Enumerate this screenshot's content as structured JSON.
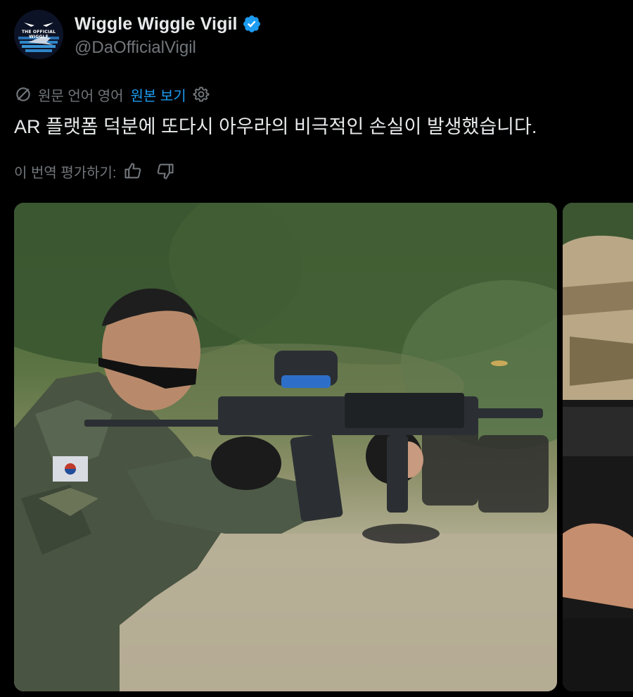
{
  "profile": {
    "display_name": "Wiggle Wiggle Vigil",
    "handle": "@DaOfficialVigil",
    "avatar_text": "THE OFFICIAL WIGGLE",
    "verified": true,
    "verified_color": "#1d9bf0"
  },
  "translation": {
    "translated_from": "원문 언어 영어",
    "show_original": "원본 보기",
    "icon": "translate-icon",
    "settings_icon": "gear-icon"
  },
  "tweet": {
    "text": "AR 플랫폼 덕분에 또다시 아우라의 비극적인 손실이 발생했습니다."
  },
  "rating": {
    "label": "이 번역 평가하기:",
    "thumbs_up_icon": "thumbs-up-icon",
    "thumbs_down_icon": "thumbs-down-icon"
  },
  "media": {
    "count": 2,
    "items": [
      "photo",
      "photo"
    ]
  },
  "colors": {
    "background": "#000000",
    "text_primary": "#e7e9ea",
    "text_secondary": "#71767b",
    "accent": "#1d9bf0"
  }
}
